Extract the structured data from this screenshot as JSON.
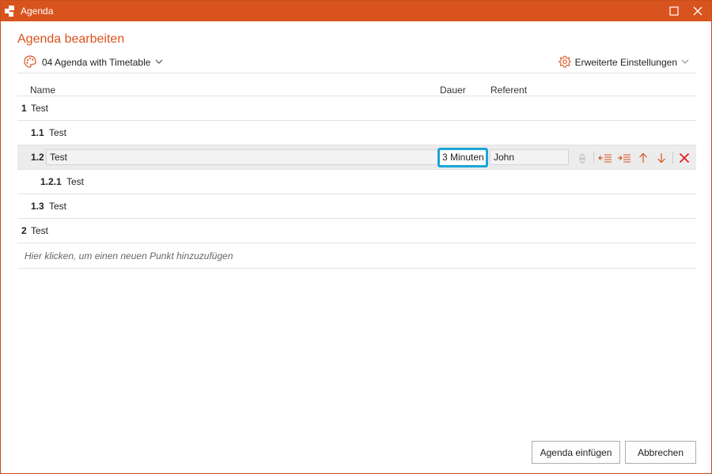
{
  "window": {
    "title": "Agenda"
  },
  "dialog": {
    "heading": "Agenda bearbeiten"
  },
  "toolbar": {
    "template_label": "04 Agenda with Timetable",
    "advanced_label": "Erweiterte Einstellungen"
  },
  "columns": {
    "name": "Name",
    "duration": "Dauer",
    "speaker": "Referent"
  },
  "items": [
    {
      "number": "1",
      "title": "Test"
    },
    {
      "number": "1.1",
      "title": "Test"
    },
    {
      "number": "1.2",
      "title": "Test",
      "duration": "3 Minuten",
      "speaker": "John"
    },
    {
      "number": "1.2.1",
      "title": "Test"
    },
    {
      "number": "1.3",
      "title": "Test"
    },
    {
      "number": "2",
      "title": "Test"
    }
  ],
  "add_hint": "Hier klicken, um einen neuen Punkt hinzuzufügen",
  "buttons": {
    "insert": "Agenda einfügen",
    "cancel": "Abbrechen"
  },
  "icons": {
    "app": "app-logo-icon",
    "template": "palette-icon",
    "settings": "gear-icon",
    "row_actions": [
      "drag-handle-icon",
      "outdent-icon",
      "indent-icon",
      "arrow-up-icon",
      "arrow-down-icon",
      "delete-icon"
    ]
  },
  "colors": {
    "accent": "#d9531e",
    "focus": "#1aa6d6",
    "delete": "#e02020"
  }
}
